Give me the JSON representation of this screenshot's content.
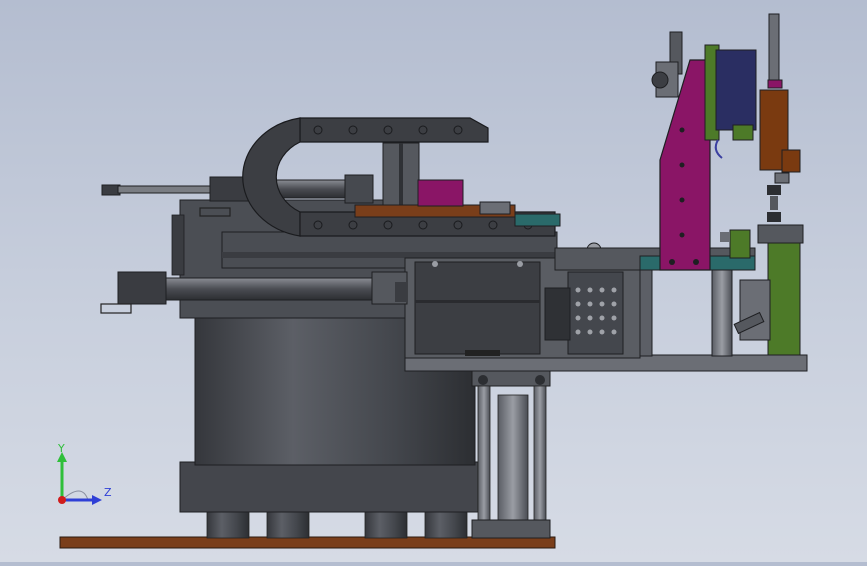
{
  "triad": {
    "y_label": "Y",
    "z_label": "Z",
    "y_color": "#2fbf3a",
    "z_color": "#2f3fd6",
    "origin_color": "#d01c1c"
  },
  "colors": {
    "dark_body": "#3d3f45",
    "mid_body": "#54575e",
    "light_body": "#6b6e75",
    "magenta_plate": "#8a1566",
    "brown_part": "#7a3a10",
    "green_part": "#4d7a28",
    "teal_bar": "#2a6a6a",
    "navy_motor": "#2a2e62",
    "base_plate": "#7a3e1a"
  }
}
